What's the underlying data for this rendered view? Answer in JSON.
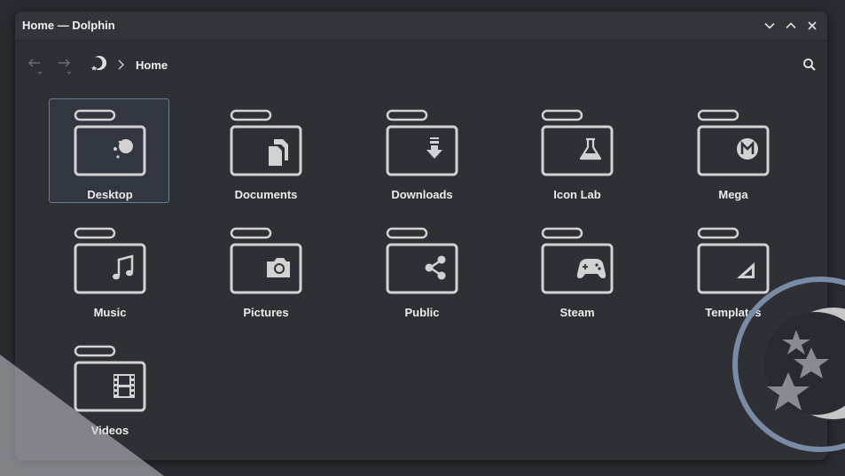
{
  "window": {
    "title": "Home — Dolphin"
  },
  "window_controls": {
    "minimize_icon": "chevron-down-icon",
    "maximize_icon": "chevron-up-icon",
    "close_icon": "close-icon"
  },
  "toolbar": {
    "breadcrumb_root_icon": "moon-stars-icon",
    "breadcrumb_current": "Home",
    "search_icon": "search-icon"
  },
  "folders": [
    {
      "label": "Desktop",
      "emblem": "desktop-icon",
      "selected": true
    },
    {
      "label": "Documents",
      "emblem": "documents-icon"
    },
    {
      "label": "Downloads",
      "emblem": "download-arrow-icon"
    },
    {
      "label": "Icon Lab",
      "emblem": "flask-icon"
    },
    {
      "label": "Mega",
      "emblem": "mega-icon"
    },
    {
      "label": "Music",
      "emblem": "music-note-icon"
    },
    {
      "label": "Pictures",
      "emblem": "camera-icon"
    },
    {
      "label": "Public",
      "emblem": "share-icon"
    },
    {
      "label": "Steam",
      "emblem": "gamepad-icon"
    },
    {
      "label": "Templates",
      "emblem": "template-icon"
    },
    {
      "label": "Videos",
      "emblem": "film-icon"
    }
  ],
  "colors": {
    "background": "#2a2b30",
    "window": "#2f3036",
    "icon_stroke": "#d2d2d2",
    "accent_ring": "#7a8ba6"
  }
}
